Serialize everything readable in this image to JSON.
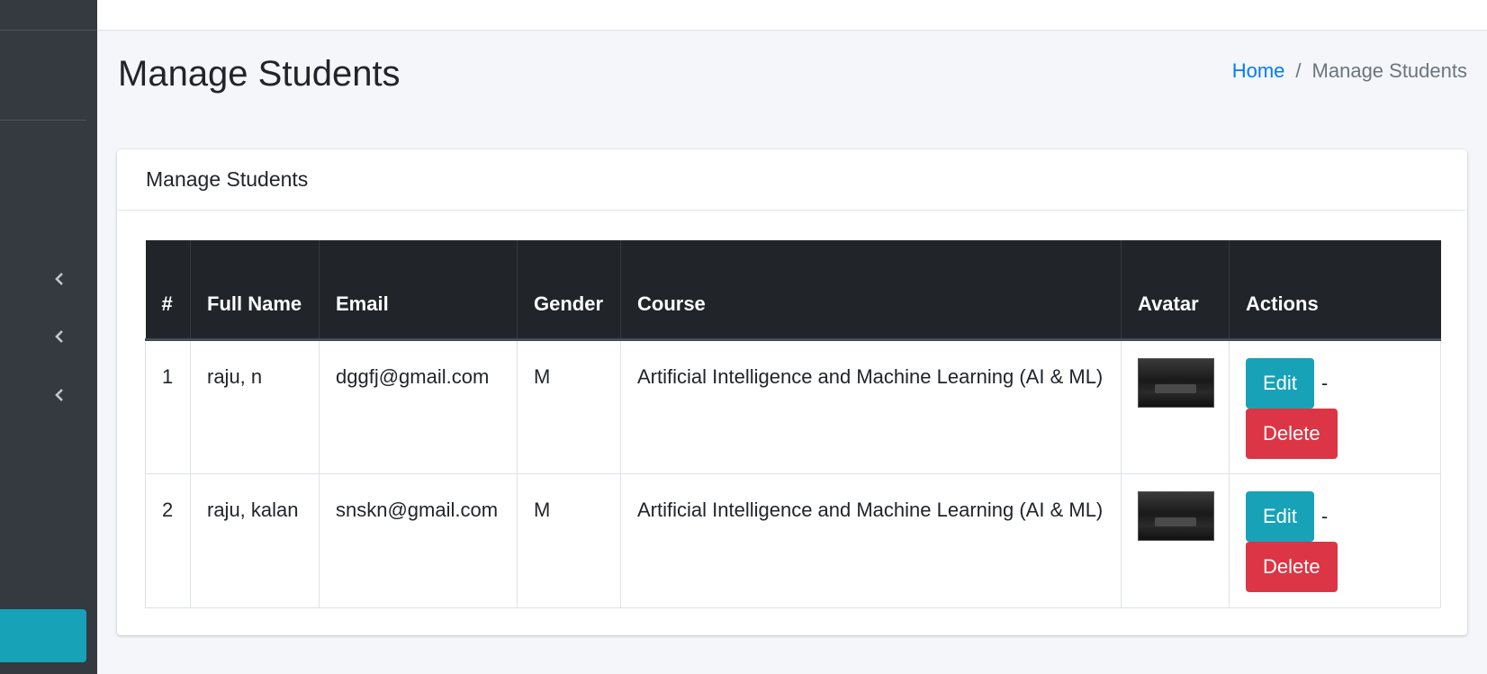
{
  "page": {
    "title": "Manage Students"
  },
  "breadcrumb": {
    "home": "Home",
    "separator": "/",
    "current": "Manage Students"
  },
  "card": {
    "title": "Manage Students"
  },
  "table": {
    "columns": [
      "#",
      "Full Name",
      "Email",
      "Gender",
      "Course",
      "Avatar",
      "Actions"
    ],
    "rows": [
      {
        "num": "1",
        "name": "raju, n",
        "email": "dggfj@gmail.com",
        "gender": "M",
        "course": "Artificial Intelligence and Machine Learning (AI & ML)"
      },
      {
        "num": "2",
        "name": "raju, kalan",
        "email": "snskn@gmail.com",
        "gender": "M",
        "course": "Artificial Intelligence and Machine Learning (AI & ML)"
      }
    ]
  },
  "actions": {
    "edit_label": "Edit",
    "delete_label": "Delete",
    "separator": "-"
  },
  "sidebar": {
    "icons": [
      "chevron-left-icon",
      "chevron-left-icon",
      "chevron-left-icon"
    ]
  },
  "colors": {
    "sidebar": "#343a40",
    "accent": "#17a2b8",
    "danger": "#dc3545",
    "link": "#007bff",
    "table_head": "#212529"
  }
}
